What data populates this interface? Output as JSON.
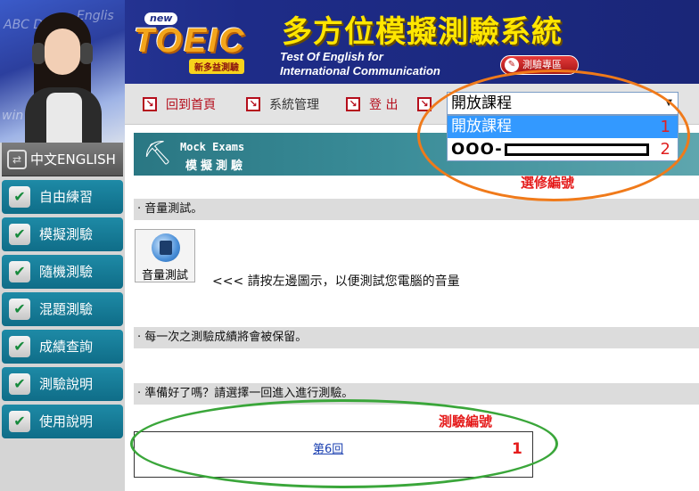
{
  "header": {
    "logo_badge": "new",
    "logo_word": "TOEIC",
    "logo_subtitle": "新多益測驗",
    "system_title": "多方位模擬測驗系統",
    "subtitle_line1": "Test Of English for",
    "subtitle_line2": "International Communication",
    "exam_button_label": "測驗專區"
  },
  "nav": {
    "home_label": "回到首頁",
    "system_label": "系統管理",
    "logout_label": "登 出",
    "arrow_glyph": "↘"
  },
  "course_select": {
    "selected_value": "開放課程",
    "options": [
      {
        "label": "開放課程",
        "number": "1"
      },
      {
        "label": "OOO-",
        "number": "2"
      }
    ],
    "annotation": "選修編號"
  },
  "sidebar": {
    "language_label": "中文ENGLISH",
    "items": [
      {
        "label": "自由練習"
      },
      {
        "label": "模擬測驗"
      },
      {
        "label": "隨機測驗"
      },
      {
        "label": "混題測驗"
      },
      {
        "label": "成績查詢"
      },
      {
        "label": "測驗說明"
      },
      {
        "label": "使用說明"
      }
    ]
  },
  "main": {
    "banner_en": "Mock Exams",
    "banner_zh": "模擬測驗",
    "sound_section": "· 音量測試。",
    "sound_button_label": "音量測試",
    "sound_hint": "<<<  請按左邊圖示，以便測試您電腦的音量",
    "saved_section": "· 每一次之測驗成績將會被保留。",
    "ready_section": "· 準備好了嗎？請選擇一回進入進行測驗。",
    "exam_link": "第6回",
    "exam_annotation": "測驗編號",
    "exam_annotation_number": "1"
  },
  "colors": {
    "header_blue": "#1f2d86",
    "title_yellow": "#ffe600",
    "nav_red": "#b50e1c",
    "sidebar_teal": "#1e8aa6",
    "banner_teal": "#2a7783",
    "annotation_orange": "#f07a1a",
    "annotation_green": "#3aa63a",
    "annotation_red": "#e51c1c",
    "dropdown_highlight": "#3399ff"
  }
}
